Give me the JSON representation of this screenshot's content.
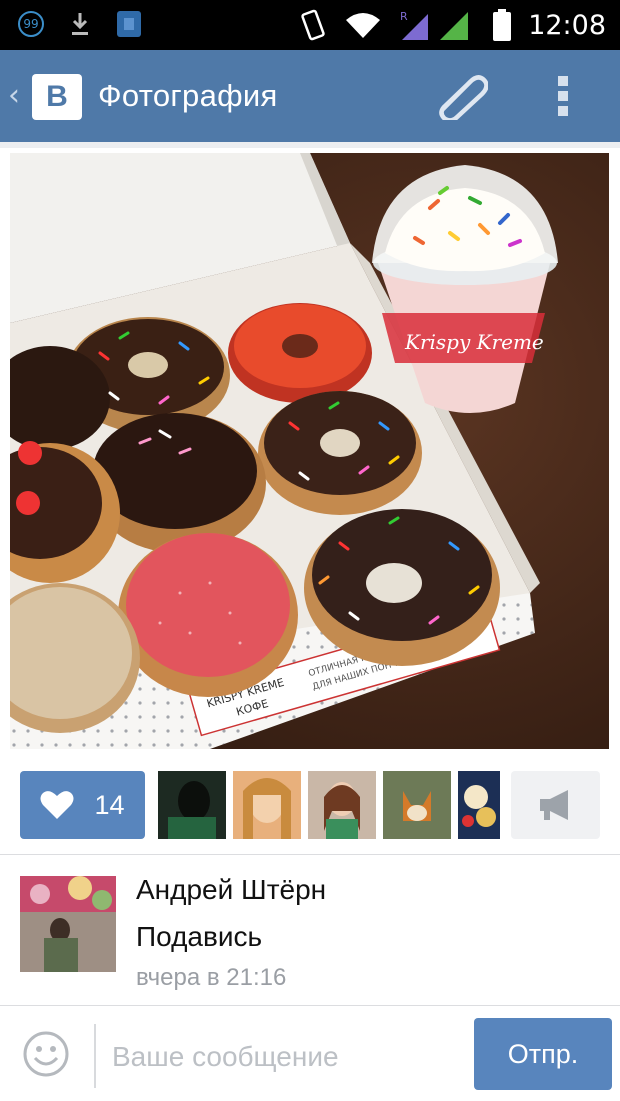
{
  "status_bar": {
    "notification_badge": "99",
    "time": "12:08",
    "roaming_indicator": "R"
  },
  "header": {
    "logo_letter": "B",
    "title": "Фотография"
  },
  "likes": {
    "count": "14"
  },
  "post": {
    "author": "Андрей Штёрн",
    "caption": "Подавись",
    "timestamp": "вчера в 21:16"
  },
  "photo": {
    "box_brand": "KRISPY KREME",
    "box_sub": "КОФЕ",
    "box_note_1": "ОТЛИЧНАЯ ПАРА",
    "box_note_2": "ДЛЯ НАШИХ ПОНЧИКОВ",
    "cup_brand": "Krispy Kreme"
  },
  "composer": {
    "placeholder": "Ваше сообщение",
    "send_label": "Отпр."
  },
  "colors": {
    "status_bar": "#000000",
    "app_bar": "#4f79a8",
    "accent_button": "#5885bd",
    "background": "#eceef1"
  },
  "icons": [
    "notification-badge-icon",
    "download-icon",
    "sim-icon",
    "phone-rotate-icon",
    "wifi-icon",
    "signal-icon",
    "battery-icon",
    "back-chevron-icon",
    "vk-logo-icon",
    "paperclip-icon",
    "overflow-menu-icon",
    "heart-icon",
    "megaphone-icon",
    "smiley-icon"
  ]
}
